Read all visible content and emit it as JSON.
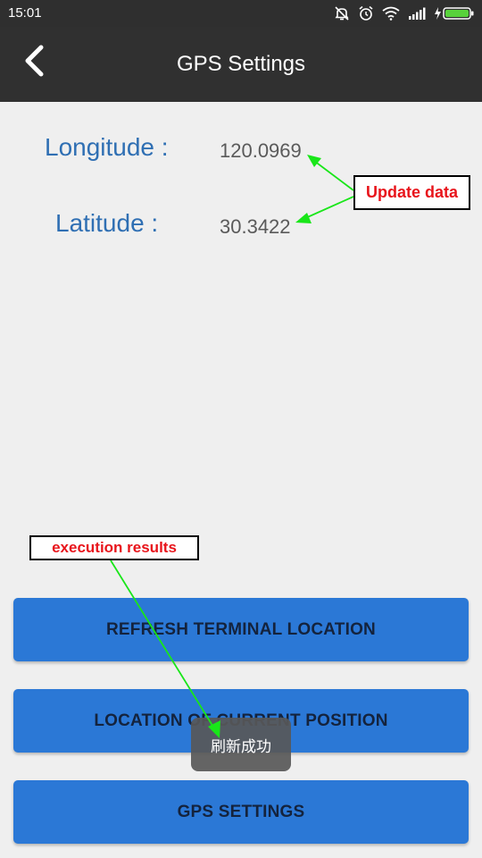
{
  "status_bar": {
    "time": "15:01",
    "icons": [
      "mute-icon",
      "alarm-icon",
      "wifi-icon",
      "signal-icon",
      "battery-charging-icon"
    ]
  },
  "app_bar": {
    "title": "GPS Settings",
    "back_icon": "chevron-left-icon"
  },
  "location": {
    "longitude_label": "Longitude :",
    "longitude_value": "120.0969",
    "latitude_label": "Latitude :",
    "latitude_value": "30.3422"
  },
  "buttons": {
    "refresh": "REFRESH TERMINAL LOCATION",
    "current_position": "LOCATION OF CURRENT POSITION",
    "gps_settings": "GPS SETTINGS"
  },
  "toast": {
    "text": "刷新成功"
  },
  "annotations": {
    "update_data": "Update data",
    "execution_results": "execution results"
  },
  "colors": {
    "status_bar_bg": "#2f2f2f",
    "app_bar_bg": "#303030",
    "page_bg": "#efefef",
    "label_blue": "#2f6fb3",
    "button_blue": "#2b78d6",
    "annotation_red": "#e8141b",
    "arrow_green": "#19e619"
  }
}
